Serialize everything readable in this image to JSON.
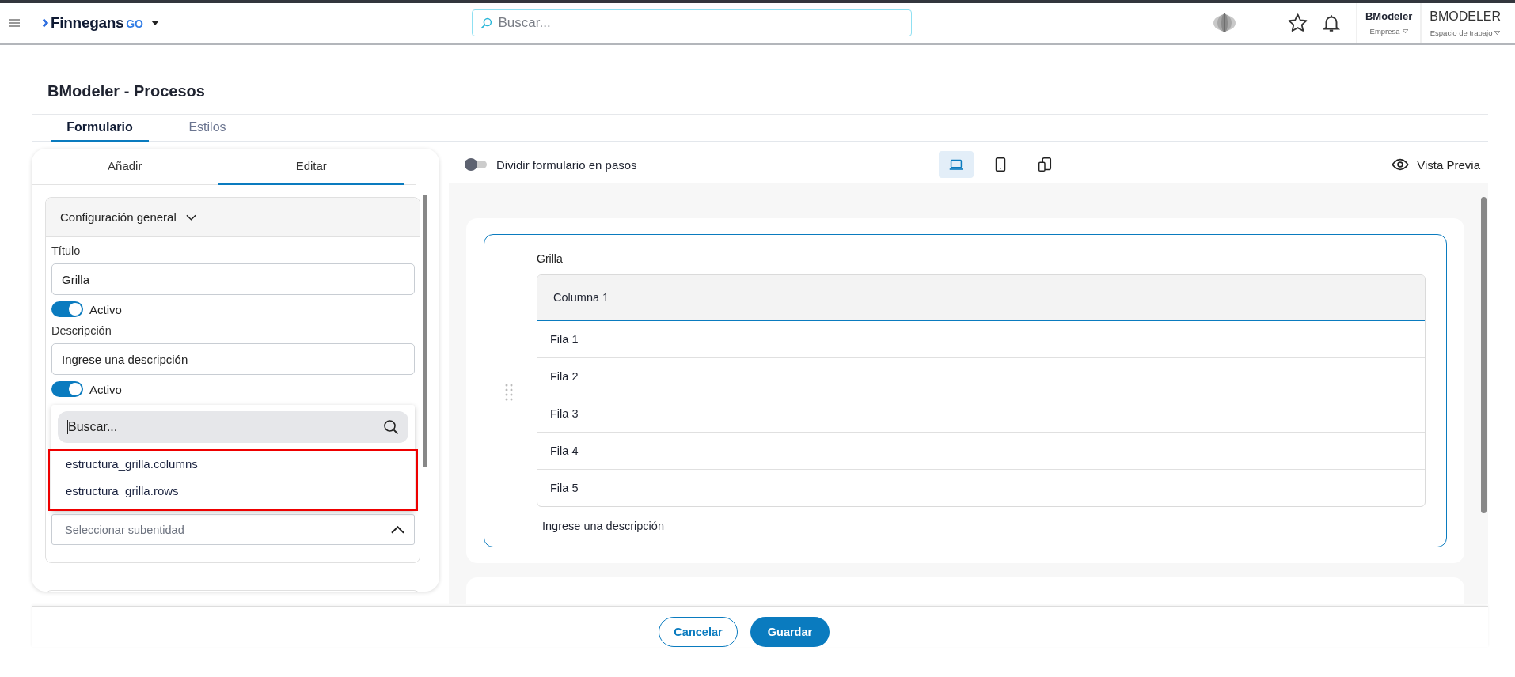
{
  "header": {
    "brand": "Finnegans",
    "brand_suffix": "GO",
    "search": {
      "placeholder": "Buscar..."
    },
    "company": {
      "name": "BModeler",
      "label": "Empresa"
    },
    "workspace": {
      "name": "BMODELER",
      "label": "Espacio de trabajo"
    }
  },
  "page": {
    "title": "BModeler - Procesos"
  },
  "tabs": [
    {
      "label": "Formulario",
      "selected": true
    },
    {
      "label": "Estilos",
      "selected": false
    }
  ],
  "left_panel": {
    "tabs": [
      {
        "label": "Añadir",
        "selected": false
      },
      {
        "label": "Editar",
        "selected": true
      }
    ],
    "section": {
      "title": "Configuración general",
      "expanded": true,
      "fields": [
        {
          "label": "Título",
          "value": "Grilla",
          "toggle_label": "Activo",
          "toggle_on": true
        },
        {
          "label": "Descripción",
          "value": "Ingrese una descripción",
          "toggle_label": "Activo",
          "toggle_on": true
        }
      ],
      "dropdown": {
        "search_placeholder": "Buscar...",
        "highlighted": true,
        "options": [
          "estructura_grilla.columns",
          "estructura_grilla.rows"
        ]
      },
      "subentity": {
        "placeholder": "Seleccionar subentidad",
        "expanded": true
      }
    }
  },
  "toolbar": {
    "split_steps": {
      "label": "Dividir formulario en pasos",
      "on": false
    },
    "devices": [
      {
        "kind": "laptop",
        "selected": true
      },
      {
        "kind": "tablet",
        "selected": false
      },
      {
        "kind": "mobile",
        "selected": false
      }
    ],
    "preview": "Vista Previa"
  },
  "grid": {
    "title": "Grilla",
    "column": "Columna 1",
    "rows": [
      "Fila 1",
      "Fila 2",
      "Fila 3",
      "Fila 4",
      "Fila 5"
    ],
    "description": "Ingrese una descripción"
  },
  "buttons": {
    "cancel": "Cancelar",
    "save": "Guardar"
  }
}
